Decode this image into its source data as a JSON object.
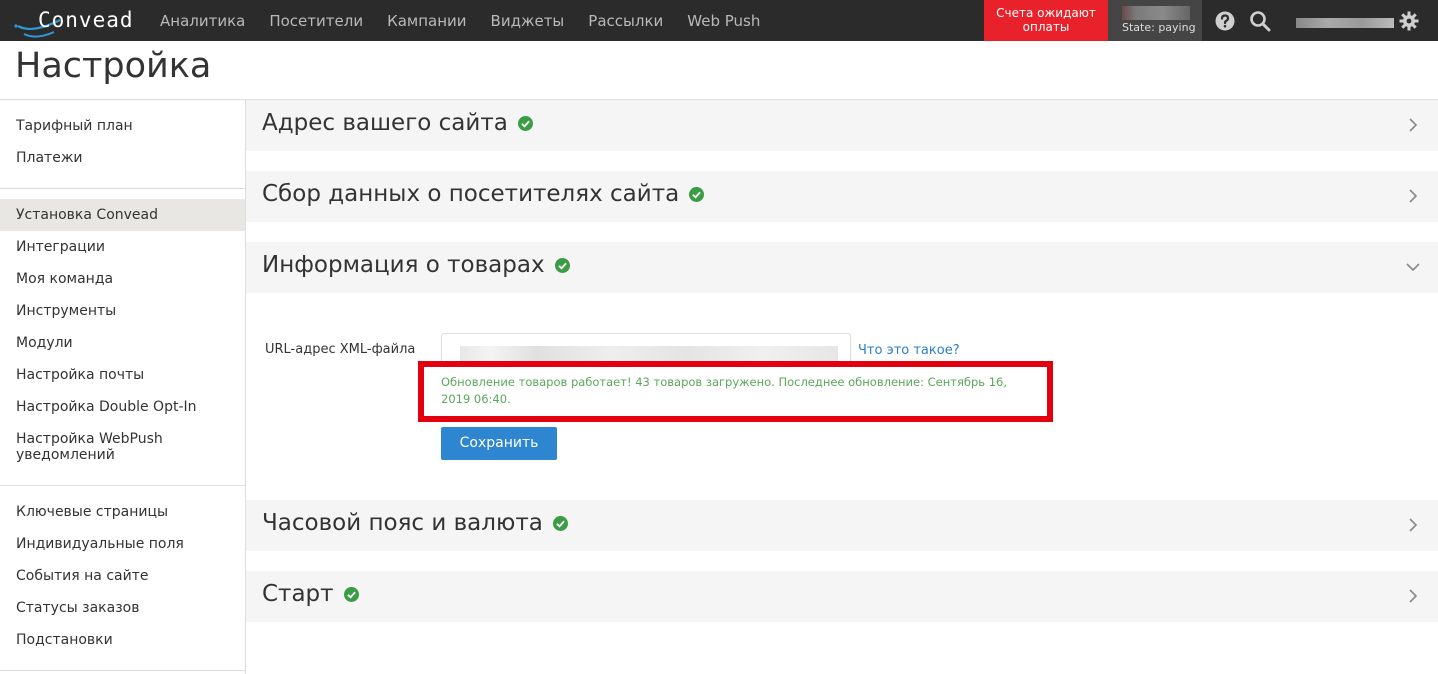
{
  "brand": {
    "name": "Convead"
  },
  "nav": {
    "links": [
      "Аналитика",
      "Посетители",
      "Кампании",
      "Виджеты",
      "Рассылки",
      "Web Push"
    ],
    "alert": "Счета ожидают оплаты",
    "state": "State: paying"
  },
  "page": {
    "title": "Настройка"
  },
  "sidebar": {
    "groups": [
      [
        "Тарифный план",
        "Платежи"
      ],
      [
        "Установка Convead",
        "Интеграции",
        "Моя команда",
        "Инструменты",
        "Модули",
        "Настройка почты",
        "Настройка Double Opt-In",
        "Настройка WebPush уведомлений"
      ],
      [
        "Ключевые страницы",
        "Индивидуальные поля",
        "События на сайте",
        "Статусы заказов",
        "Подстановки"
      ]
    ],
    "active": "Установка Convead"
  },
  "sections": [
    {
      "title": "Адрес вашего сайта",
      "status": "ok",
      "expanded": false
    },
    {
      "title": "Сбор данных о посетителях сайта",
      "status": "ok",
      "expanded": false
    },
    {
      "title": "Информация о товарах",
      "status": "ok",
      "expanded": true
    },
    {
      "title": "Часовой пояс и валюта",
      "status": "ok",
      "expanded": false
    },
    {
      "title": "Старт",
      "status": "ok",
      "expanded": false
    }
  ],
  "products": {
    "field_label": "URL-адрес XML-файла",
    "help_link": "Что это такое?",
    "status_message": "Обновление товаров работает! 43 товаров загружено. Последнее обновление: Сентябрь 16, 2019 06:40.",
    "save_label": "Сохранить"
  },
  "colors": {
    "navbar": "#2b2b2b",
    "alert": "#e8212a",
    "accent": "#2e85d0",
    "success": "#3a9d44",
    "highlight_border": "#e3000f"
  }
}
